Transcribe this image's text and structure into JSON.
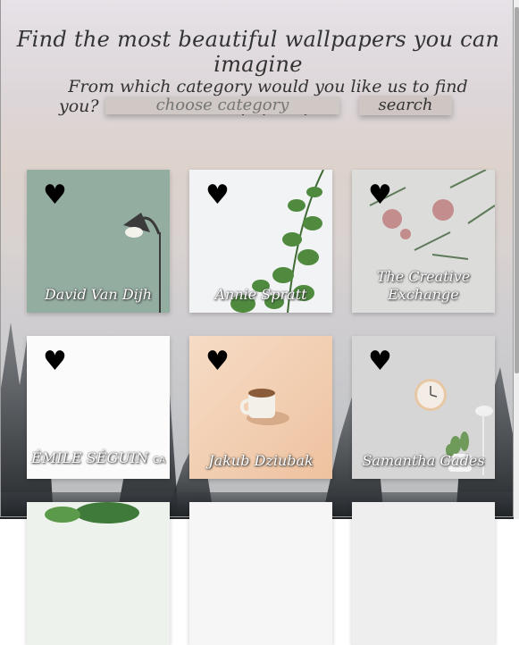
{
  "header": {
    "title": "Find the most beautiful wallpapers you can imagine",
    "question_line1": "From which category would you like us to find wallpapers for",
    "question_line2": "you?"
  },
  "search": {
    "placeholder": "choose category",
    "button_label": "search"
  },
  "cards": [
    {
      "author": "David Van Dijh",
      "like_icon": "heart-icon"
    },
    {
      "author": "Annie Spratt",
      "like_icon": "heart-icon"
    },
    {
      "author": "The Creative Exchange",
      "like_icon": "heart-icon"
    },
    {
      "author_main": "ÉMILE SÉGUIN",
      "author_suffix": "CA",
      "like_icon": "heart-icon"
    },
    {
      "author": "Jakub Dziubak",
      "like_icon": "heart-icon"
    },
    {
      "author": "Samantha Gades",
      "like_icon": "heart-icon"
    }
  ],
  "heart_symbol": "♥"
}
